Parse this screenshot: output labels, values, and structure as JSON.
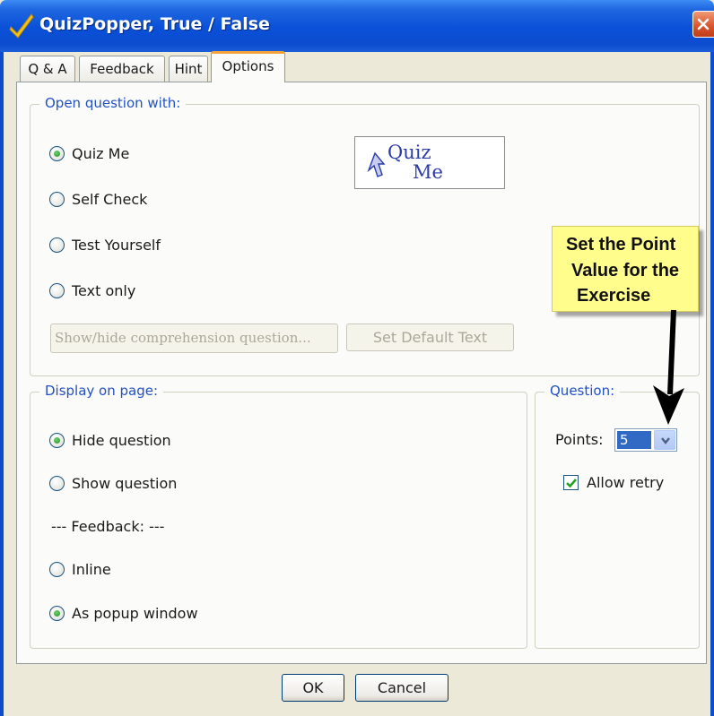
{
  "window": {
    "title": "QuizPopper, True / False",
    "app_icon": "checkmark-icon",
    "close_icon": "close-icon"
  },
  "tabs": [
    {
      "label": "Q & A",
      "active": false
    },
    {
      "label": "Feedback",
      "active": false
    },
    {
      "label": "Hint",
      "active": false
    },
    {
      "label": "Options",
      "active": true
    }
  ],
  "open_question": {
    "legend": "Open question with:",
    "options": [
      {
        "label": "Quiz Me",
        "checked": true
      },
      {
        "label": "Self Check",
        "checked": false
      },
      {
        "label": "Test Yourself",
        "checked": false
      },
      {
        "label": "Text only",
        "checked": false
      }
    ],
    "preview": {
      "line1": "Quiz",
      "line2": "Me",
      "icon": "cursor-arrow-icon"
    },
    "comprehension_button": "Show/hide comprehension question...",
    "default_text_button": "Set Default Text"
  },
  "display_on_page": {
    "legend": "Display on page:",
    "options": [
      {
        "label": "Hide question",
        "checked": true
      },
      {
        "label": "Show question",
        "checked": false
      }
    ],
    "feedback_label": "--- Feedback: ---",
    "feedback_options": [
      {
        "label": "Inline",
        "checked": false
      },
      {
        "label": "As popup window",
        "checked": true
      }
    ]
  },
  "question": {
    "legend": "Question:",
    "points_label": "Points:",
    "points_value": "5",
    "allow_retry_label": "Allow retry",
    "allow_retry_checked": true
  },
  "callout": {
    "line1": "Set the Point",
    "line2": "Value for the",
    "line3": "Exercise",
    "color": "#fffd8c"
  },
  "footer": {
    "ok_label": "OK",
    "cancel_label": "Cancel"
  },
  "colors": {
    "titlebar": "#0a50d8",
    "accent_tab": "#f5a43b",
    "legend_text": "#2151c4"
  }
}
